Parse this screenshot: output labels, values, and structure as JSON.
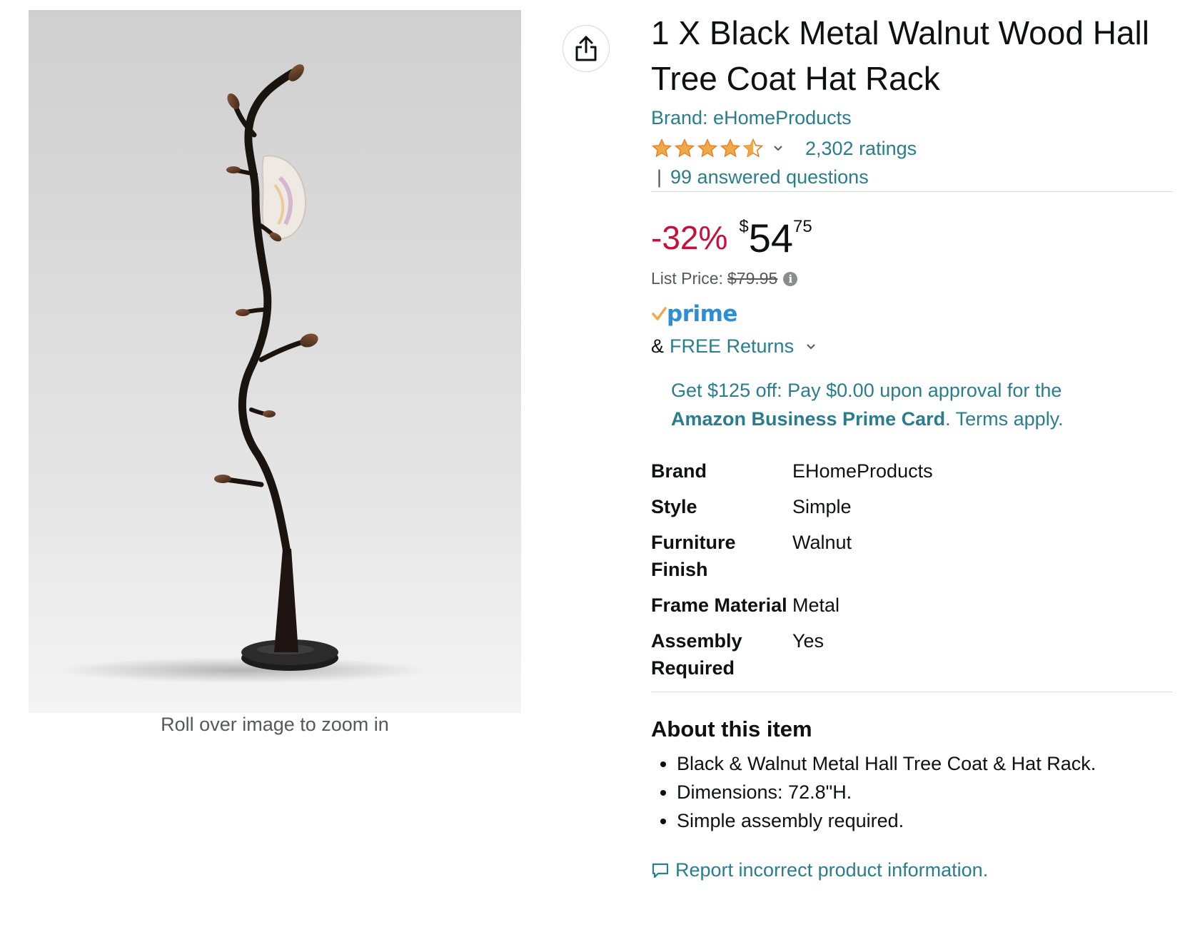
{
  "image": {
    "zoom_hint": "Roll over image to zoom in"
  },
  "product": {
    "title": "1 X Black Metal Walnut Wood Hall Tree Coat Hat Rack",
    "brand_link": "Brand: eHomeProducts",
    "rating_stars": 4.5,
    "ratings_count": "2,302 ratings",
    "answered_questions": "99 answered questions",
    "qa_separator": "|"
  },
  "price": {
    "discount": "-32%",
    "symbol": "$",
    "whole": "54",
    "fraction": "75",
    "list_label": "List Price:",
    "list_value": "$79.95"
  },
  "shipping": {
    "prime_label": "prime",
    "returns_prefix": "&",
    "returns_link": "FREE Returns"
  },
  "promo": {
    "text_before": "Get $125 off: Pay $0.00 upon approval for the ",
    "bold": "Amazon Business Prime Card",
    "text_after": ". Terms apply."
  },
  "specs": [
    {
      "key": "Brand",
      "value": "EHomeProducts"
    },
    {
      "key": "Style",
      "value": "Simple"
    },
    {
      "key": "Furniture Finish",
      "value": "Walnut"
    },
    {
      "key": "Frame Material",
      "value": "Metal"
    },
    {
      "key": "Assembly Required",
      "value": "Yes"
    }
  ],
  "about": {
    "title": "About this item",
    "bullets": [
      "Black & Walnut Metal Hall Tree Coat & Hat Rack.",
      "Dimensions: 72.8\"H.",
      "Simple assembly required."
    ]
  },
  "report_link": "Report incorrect product information.",
  "icons": {
    "share": "share-icon",
    "info": "info-icon",
    "chevron": "chevron-down-icon",
    "report": "comment-icon",
    "prime_check": "prime-check-icon"
  },
  "colors": {
    "link": "#2a7d8c",
    "discount": "#cc0c39",
    "star": "#f3a847",
    "prime": "#2a8fd6"
  }
}
